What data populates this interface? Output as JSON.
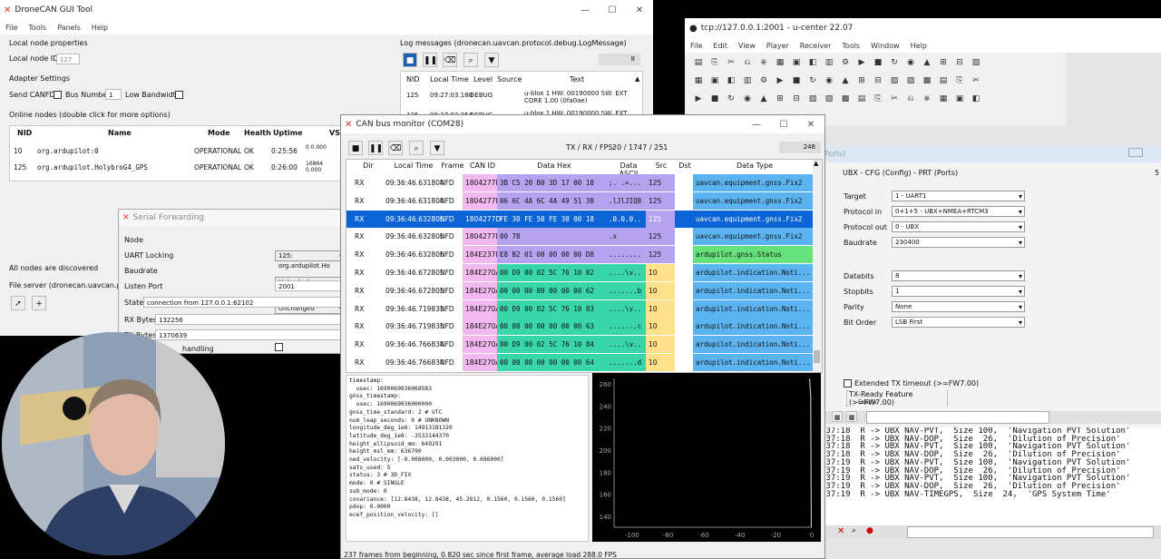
{
  "dronecan": {
    "title": "DroneCAN GUI Tool",
    "menu": [
      "File",
      "Tools",
      "Panels",
      "Help"
    ],
    "local_node_props": "Local node properties",
    "local_node_id_label": "Local node ID:",
    "local_node_id_value": "127",
    "adapter_settings": "Adapter Settings",
    "send_canfd": "Send CANFD:",
    "bus_number": "Bus Number:",
    "bus_number_value": "1",
    "low_bandwidth": "Low Bandwidth:",
    "online_nodes": "Online nodes (double click for more options)",
    "node_cols": [
      "NID",
      "Name",
      "Mode",
      "Health",
      "Uptime",
      "VS"
    ],
    "nodes": [
      {
        "nid": "10",
        "name": "org.ardupilot:0",
        "mode": "OPERATIONAL",
        "health": "OK",
        "uptime": "0:25:56",
        "vs": "0 0.000"
      },
      {
        "nid": "125",
        "name": "org.ardupilot.HolybroG4_GPS",
        "mode": "OPERATIONAL",
        "health": "OK",
        "uptime": "0:26:00",
        "vs": "16864 0.000"
      }
    ],
    "all_nodes_discovered": "All nodes are discovered",
    "file_server": "File server (dronecan.uavcan.protoco",
    "log_title": "Log messages (dronecan.uavcan.protocol.debug.LogMessage)",
    "log_count": "8",
    "log_cols": [
      "NID",
      "Local Time",
      "Level",
      "Source",
      "Text"
    ],
    "log_rows": [
      {
        "nid": "125",
        "time": "09:27:03.180",
        "level": "DEBUG",
        "source": "",
        "text": "u-blox 1 HW: 00190000 SW: EXT CORE 1.00 (0fa0ae)"
      },
      {
        "nid": "125",
        "time": "09:27:03.254",
        "level": "DEBUG",
        "source": "",
        "text": "u-blox 1 HW: 00190000 SW: EXT"
      }
    ]
  },
  "serial": {
    "title": "Serial Forwarding",
    "node_label": "Node",
    "node_value": "125: org.ardupilot.Ho",
    "uart_label": "UART Locking",
    "uart_value": "UnLocked",
    "baud_label": "Baudrate",
    "baud_value": "Unchanged",
    "port_label": "Listen Port",
    "port_value": "2001",
    "state_label": "State",
    "state_value": "connection from 127.0.0.1:62102",
    "rx_label": "RX Bytes",
    "rx_value": "132256",
    "tx_label": "TX Bytes",
    "tx_value": "1370639",
    "handling_label": "handling"
  },
  "ucenter": {
    "title": "tcp://127.0.0.1:2001 - u-center 22.07",
    "menu": [
      "File",
      "Edit",
      "View",
      "Player",
      "Receiver",
      "Tools",
      "Window",
      "Help"
    ],
    "ports_title": "Ports)",
    "cfg_title": "UBX - CFG (Config) - PRT (Ports)",
    "cfg_right": "5",
    "fields": [
      {
        "label": "Target",
        "value": "1 - UART1"
      },
      {
        "label": "Protocol in",
        "value": "0+1+5 - UBX+NMEA+RTCM3"
      },
      {
        "label": "Protocol out",
        "value": "0 - UBX"
      },
      {
        "label": "Baudrate",
        "value": "230400"
      }
    ],
    "fields2": [
      {
        "label": "Databits",
        "value": "8"
      },
      {
        "label": "Stopbits",
        "value": "1"
      },
      {
        "label": "Parity",
        "value": "None"
      },
      {
        "label": "Bit Order",
        "value": "LSB First"
      }
    ],
    "ext_timeout": "Extended TX timeout (>=FW7.00)",
    "tx_ready": "TX-Ready Feature (>=FW7.00)",
    "enable": "Enable",
    "console": [
      ":37:18  R -> UBX NAV-PVT,  Size 100,  'Navigation PVT Solution'",
      ":37:18  R -> UBX NAV-DOP,  Size  26,  'Dilution of Precision'",
      ":37:18  R -> UBX NAV-PVT,  Size 100,  'Navigation PVT Solution'",
      ":37:18  R -> UBX NAV-DOP,  Size  26,  'Dilution of Precision'",
      ":37:19  R -> UBX NAV-PVT,  Size 100,  'Navigation PVT Solution'",
      ":37:19  R -> UBX NAV-DOP,  Size  26,  'Dilution of Precision'",
      ":37:19  R -> UBX NAV-PVT,  Size 100,  'Navigation PVT Solution'",
      ":37:19  R -> UBX NAV-DOP,  Size  26,  'Dilution of Precision'",
      ":37:19  R -> UBX NAV-TIMEGPS,  Size  24,  'GPS System Time'"
    ]
  },
  "canmon": {
    "title": "CAN bus monitor (COM28)",
    "fps_label": "TX / RX / FPS:",
    "fps_value": "20 / 1747 / 251",
    "count": "248",
    "cols": [
      "Dir",
      "Local Time",
      "Frame",
      "CAN ID",
      "Data Hex",
      "Data ASCII",
      "Src",
      "Dst",
      "Data Type"
    ],
    "rows": [
      {
        "dir": "RX",
        "time": "09:36:46.631804",
        "frame": "NFD",
        "id": "1804277D",
        "hex": "3B C5 20 B0 3D 17 00 18",
        "ascii": ";. .=...",
        "src": "125",
        "dst": "",
        "type": "uavcan.equipment.gnss.Fix2",
        "hexc": "#b5a3f0",
        "srcc": "#b5a3f0",
        "typec": "#5bb4f0",
        "sel": false
      },
      {
        "dir": "RX",
        "time": "09:36:46.631804",
        "frame": "NFD",
        "id": "1804277D",
        "hex": "06 6C 4A 6C 4A 49 51 38",
        "ascii": ".lJlJIQ8",
        "src": "125",
        "dst": "",
        "type": "uavcan.equipment.gnss.Fix2",
        "hexc": "#b5a3f0",
        "srcc": "#b5a3f0",
        "typec": "#5bb4f0",
        "sel": false
      },
      {
        "dir": "RX",
        "time": "09:36:46.632806",
        "frame": "NFD",
        "id": "1804277D",
        "hex": "FE 30 FE 50 FE 30 00 18",
        "ascii": ".0.0.0..",
        "src": "125",
        "dst": "",
        "type": "uavcan.equipment.gnss.Fix2",
        "hexc": "#b5a3f0",
        "srcc": "#b5a3f0",
        "typec": "#5bb4f0",
        "sel": true
      },
      {
        "dir": "RX",
        "time": "09:36:46.632806",
        "frame": "NFD",
        "id": "1804277D",
        "hex": "00 78",
        "ascii": ".x",
        "src": "125",
        "dst": "",
        "type": "uavcan.equipment.gnss.Fix2",
        "hexc": "#b5a3f0",
        "srcc": "#b5a3f0",
        "typec": "#5bb4f0",
        "sel": false
      },
      {
        "dir": "RX",
        "time": "09:36:46.632806",
        "frame": "NFD",
        "id": "184E237D",
        "hex": "E8 B2 01 00 00 00 00 D8",
        "ascii": "........",
        "src": "125",
        "dst": "",
        "type": "ardupilot.gnss.Status",
        "hexc": "#b5a3f0",
        "srcc": "#b5a3f0",
        "typec": "#66e07a",
        "sel": false
      },
      {
        "dir": "RX",
        "time": "09:36:46.672803",
        "frame": "NFD",
        "id": "184E270A",
        "hex": "00 D9 00 02 5C 76 10 82",
        "ascii": "....\\v..",
        "src": "10",
        "dst": "",
        "type": "ardupilot.indication.Noti...",
        "hexc": "#38d6a8",
        "srcc": "#ffe08a",
        "typec": "#5bb4f0",
        "sel": false
      },
      {
        "dir": "RX",
        "time": "09:36:46.672803",
        "frame": "NFD",
        "id": "184E270A",
        "hex": "00 00 00 00 00 00 00 62",
        "ascii": ".......b",
        "src": "10",
        "dst": "",
        "type": "ardupilot.indication.Noti...",
        "hexc": "#38d6a8",
        "srcc": "#ffe08a",
        "typec": "#5bb4f0",
        "sel": false
      },
      {
        "dir": "RX",
        "time": "09:36:46.719833",
        "frame": "NFD",
        "id": "184E270A",
        "hex": "00 D9 00 02 5C 76 10 83",
        "ascii": "....\\v..",
        "src": "10",
        "dst": "",
        "type": "ardupilot.indication.Noti...",
        "hexc": "#38d6a8",
        "srcc": "#ffe08a",
        "typec": "#5bb4f0",
        "sel": false
      },
      {
        "dir": "RX",
        "time": "09:36:46.719833",
        "frame": "NFD",
        "id": "184E270A",
        "hex": "00 00 00 00 00 00 00 63",
        "ascii": ".......c",
        "src": "10",
        "dst": "",
        "type": "ardupilot.indication.Noti...",
        "hexc": "#38d6a8",
        "srcc": "#ffe08a",
        "typec": "#5bb4f0",
        "sel": false
      },
      {
        "dir": "RX",
        "time": "09:36:46.766834",
        "frame": "NFD",
        "id": "184E270A",
        "hex": "00 D9 00 02 5C 76 10 84",
        "ascii": "....\\v..",
        "src": "10",
        "dst": "",
        "type": "ardupilot.indication.Noti...",
        "hexc": "#38d6a8",
        "srcc": "#ffe08a",
        "typec": "#5bb4f0",
        "sel": false
      },
      {
        "dir": "RX",
        "time": "09:36:46.766834",
        "frame": "NFD",
        "id": "184E270A",
        "hex": "00 00 00 00 00 00 00 64",
        "ascii": ".......d",
        "src": "10",
        "dst": "",
        "type": "ardupilot.indication.Noti...",
        "hexc": "#38d6a8",
        "srcc": "#ffe08a",
        "typec": "#5bb4f0",
        "sel": false
      }
    ],
    "decode": [
      "timestamp:",
      "  usec: 1690069036068583",
      "gnss_timestamp:",
      "  usec: 1690069036000000",
      "gnss_time_standard: 2 # UTC",
      "num_leap_seconds: 0 # UNKNOWN",
      "longitude_deg_1e8: 14913181320",
      "latitude_deg_1e8: -3533144370",
      "height_ellipsoid_mm: 649291",
      "height_msl_mm: 636790",
      "ned_velocity: [-0.008000, 0.003000, 0.086000]",
      "sats_used: 5",
      "status: 3 # 3D_FIX",
      "mode: 0 # SINGLE",
      "sub_mode: 0",
      "covariance: [12.8438, 12.8438, 45.2812, 0.1560, 0.1560, 0.1560]",
      "pdop: 0.0000",
      "ecef_position_velocity: []"
    ],
    "status_bar": "237 frames from beginning, 0.820 sec since first frame, average load 288.0 FPS"
  },
  "chart_data": {
    "type": "line",
    "yticks": [
      260,
      240,
      220,
      200,
      180,
      160,
      140
    ],
    "xticks": [
      -100,
      -80,
      -60,
      -40,
      -20,
      0
    ],
    "xlim": [
      -110,
      0
    ],
    "ylim": [
      130,
      265
    ],
    "series": [
      {
        "values": [
          [
            -1.2,
            265
          ],
          [
            -0.9,
            255
          ],
          [
            -0.6,
            250
          ],
          [
            -0.3,
            130
          ]
        ]
      }
    ]
  }
}
